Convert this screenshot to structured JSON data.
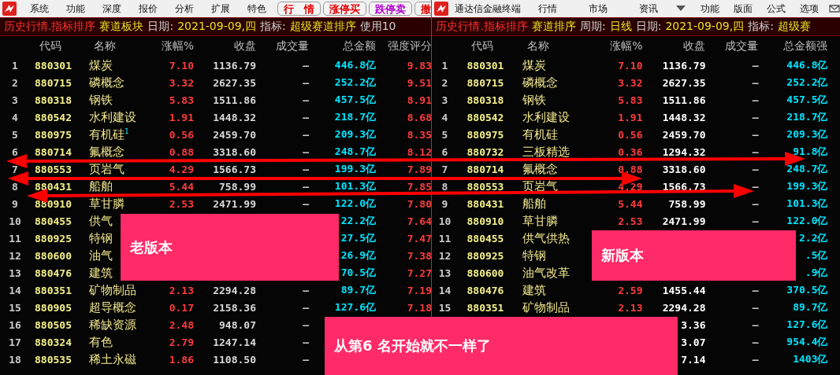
{
  "windows": [
    {
      "menu": {
        "items": [
          "系统",
          "功能",
          "深度",
          "报价",
          "分析",
          "扩展",
          "特色"
        ],
        "buttons": [
          {
            "label": "行　情",
            "color": "#e00000"
          },
          {
            "label": "涨停买",
            "color": "#e00000"
          },
          {
            "label": "跌停卖",
            "color": "#b000d0"
          },
          {
            "label": "撤",
            "color": "#e00000"
          }
        ]
      },
      "title": [
        {
          "text": "历史行情.指标排序",
          "kind": "module"
        },
        {
          "text": "赛道板块",
          "kind": "value"
        },
        {
          "text": "日期:",
          "kind": "label"
        },
        {
          "text": "2021-09-09,四",
          "kind": "value"
        },
        {
          "text": "指标:",
          "kind": "label"
        },
        {
          "text": "超级赛道排序",
          "kind": "value"
        },
        {
          "text": "使用10",
          "kind": "label"
        }
      ],
      "columns": [
        "代码",
        "名称",
        "涨幅%",
        "收盘",
        "成交量",
        "总金额",
        "强度评分"
      ],
      "rows": [
        {
          "index": "1",
          "code": "880301",
          "name": "煤炭",
          "change": "7.10",
          "close": "1136.79",
          "volume": "—",
          "amount": "446.8亿",
          "score": "9.83"
        },
        {
          "index": "2",
          "code": "880715",
          "name": "磷概念",
          "change": "3.32",
          "close": "2627.35",
          "volume": "—",
          "amount": "252.2亿",
          "score": "9.51"
        },
        {
          "index": "3",
          "code": "880318",
          "name": "钢铁",
          "change": "5.83",
          "close": "1511.86",
          "volume": "—",
          "amount": "457.5亿",
          "score": "8.91"
        },
        {
          "index": "4",
          "code": "880542",
          "name": "水利建设",
          "change": "1.91",
          "close": "1448.32",
          "volume": "—",
          "amount": "218.7亿",
          "score": "8.68"
        },
        {
          "index": "5",
          "code": "880975",
          "name": "有机硅$^{1}$",
          "change": "0.56",
          "close": "2459.70",
          "volume": "—",
          "amount": "209.3亿",
          "score": "8.35"
        },
        {
          "index": "6",
          "code": "880714",
          "name": "氟概念",
          "change": "0.88",
          "close": "3318.60",
          "volume": "—",
          "amount": "248.7亿",
          "score": "8.12"
        },
        {
          "index": "7",
          "code": "880553",
          "name": "页岩气",
          "change": "4.29",
          "close": "1566.73",
          "volume": "—",
          "amount": "199.3亿",
          "score": "7.89"
        },
        {
          "index": "8",
          "code": "880431",
          "name": "船舶",
          "change": "5.44",
          "close": "758.99",
          "volume": "—",
          "amount": "101.3亿",
          "score": "7.85"
        },
        {
          "index": "9",
          "code": "880910",
          "name": "草甘膦",
          "change": "2.53",
          "close": "2471.99",
          "volume": "—",
          "amount": "122.0亿",
          "score": "7.80"
        },
        {
          "index": "10",
          "code": "880455",
          "name": "供气",
          "amount": "22.2亿",
          "score": "7.64"
        },
        {
          "index": "11",
          "code": "880925",
          "name": "特钢",
          "amount": "27.5亿",
          "score": "7.47"
        },
        {
          "index": "12",
          "code": "880600",
          "name": "油气",
          "amount": "26.9亿",
          "score": "7.38"
        },
        {
          "index": "13",
          "code": "880476",
          "name": "建筑",
          "amount": "70.5亿",
          "score": "7.27"
        },
        {
          "index": "14",
          "code": "880351",
          "name": "矿物制品",
          "change": "2.13",
          "close": "2294.28",
          "volume": "—",
          "amount": "89.7亿",
          "score": "7.19"
        },
        {
          "index": "15",
          "code": "880905",
          "name": "超导概念",
          "change": "0.17",
          "close": "2158.36",
          "volume": "—",
          "amount": "127.6亿",
          "score": "7.18"
        },
        {
          "index": "16",
          "code": "880505",
          "name": "稀缺资源",
          "change": "2.48",
          "close": "948.07",
          "volume": "—"
        },
        {
          "index": "17",
          "code": "880324",
          "name": "有色",
          "change": "2.79",
          "close": "1247.14",
          "volume": "—"
        },
        {
          "index": "18",
          "code": "880535",
          "name": "稀土永磁",
          "change": "1.86",
          "close": "1108.50",
          "volume": "—"
        }
      ]
    },
    {
      "menu": {
        "app_name": "通达信金融终端",
        "items": [
          "行情",
          "市场",
          "资讯"
        ],
        "right_items": [
          "功能",
          "版面",
          "公式",
          "选项"
        ]
      },
      "title": [
        {
          "text": "历史行情.指标排序",
          "kind": "module"
        },
        {
          "text": "赛道排序",
          "kind": "value"
        },
        {
          "text": "周期:",
          "kind": "label"
        },
        {
          "text": "日线",
          "kind": "value"
        },
        {
          "text": "日期:",
          "kind": "label"
        },
        {
          "text": "2021-09-09,四",
          "kind": "value"
        },
        {
          "text": "指标:",
          "kind": "label"
        },
        {
          "text": "超级赛",
          "kind": "value"
        }
      ],
      "columns": [
        "代码",
        "名称",
        "涨幅%",
        "收盘",
        "成交量",
        "总金额强"
      ],
      "rows": [
        {
          "index": "1",
          "code": "880301",
          "name": "煤炭",
          "change": "7.10",
          "close": "1136.79",
          "volume": "—",
          "amount": "446.8亿"
        },
        {
          "index": "2",
          "code": "880715",
          "name": "磷概念",
          "change": "3.32",
          "close": "2627.35",
          "volume": "—",
          "amount": "252.2亿"
        },
        {
          "index": "3",
          "code": "880318",
          "name": "钢铁",
          "change": "5.83",
          "close": "1511.86",
          "volume": "—",
          "amount": "457.5亿"
        },
        {
          "index": "4",
          "code": "880542",
          "name": "水利建设",
          "change": "1.91",
          "close": "1448.32",
          "volume": "—",
          "amount": "218.7亿"
        },
        {
          "index": "5",
          "code": "880975",
          "name": "有机硅",
          "change": "0.56",
          "close": "2459.70",
          "volume": "—",
          "amount": "209.3亿"
        },
        {
          "index": "6",
          "code": "880732",
          "name": "三板精选",
          "change": "0.36",
          "close": "1294.32",
          "volume": "—",
          "amount": "91.8亿"
        },
        {
          "index": "7",
          "code": "880714",
          "name": "氟概念",
          "change": "0.88",
          "close": "3318.60",
          "volume": "—",
          "amount": "248.7亿"
        },
        {
          "index": "8",
          "code": "880553",
          "name": "页岩气",
          "change": "4.29",
          "close": "1566.73",
          "volume": "—",
          "amount": "199.3亿"
        },
        {
          "index": "9",
          "code": "880431",
          "name": "船舶",
          "change": "5.44",
          "close": "758.99",
          "volume": "—",
          "amount": "101.3亿"
        },
        {
          "index": "10",
          "code": "880910",
          "name": "草甘膦",
          "change": "2.53",
          "close": "2471.99",
          "volume": "—",
          "amount": "122.0亿"
        },
        {
          "index": "11",
          "code": "880455",
          "name": "供气供热",
          "amount": "2.2亿"
        },
        {
          "index": "12",
          "code": "880925",
          "name": "特钢",
          "amount": ".5亿"
        },
        {
          "index": "13",
          "code": "880600",
          "name": "油气改革",
          "amount": ".9亿"
        },
        {
          "index": "14",
          "code": "880476",
          "name": "建筑",
          "change": "2.59",
          "close": "1455.44",
          "volume": "—",
          "amount": "370.5亿"
        },
        {
          "index": "15",
          "code": "880351",
          "name": "矿物制品",
          "change": "2.13",
          "close": "2294.28",
          "volume": "—",
          "amount": "89.7亿"
        },
        {
          "close": "3.36",
          "volume": "—",
          "amount": "127.6亿"
        },
        {
          "close": "3.07",
          "volume": "—",
          "amount": "954.4亿"
        },
        {
          "close": "7.14",
          "volume": "—",
          "amount": "1403亿"
        }
      ]
    }
  ],
  "annotations": [
    {
      "text": "老版本"
    },
    {
      "text": "新版本"
    },
    {
      "text": "从第6 名开始就不一样了"
    }
  ]
}
